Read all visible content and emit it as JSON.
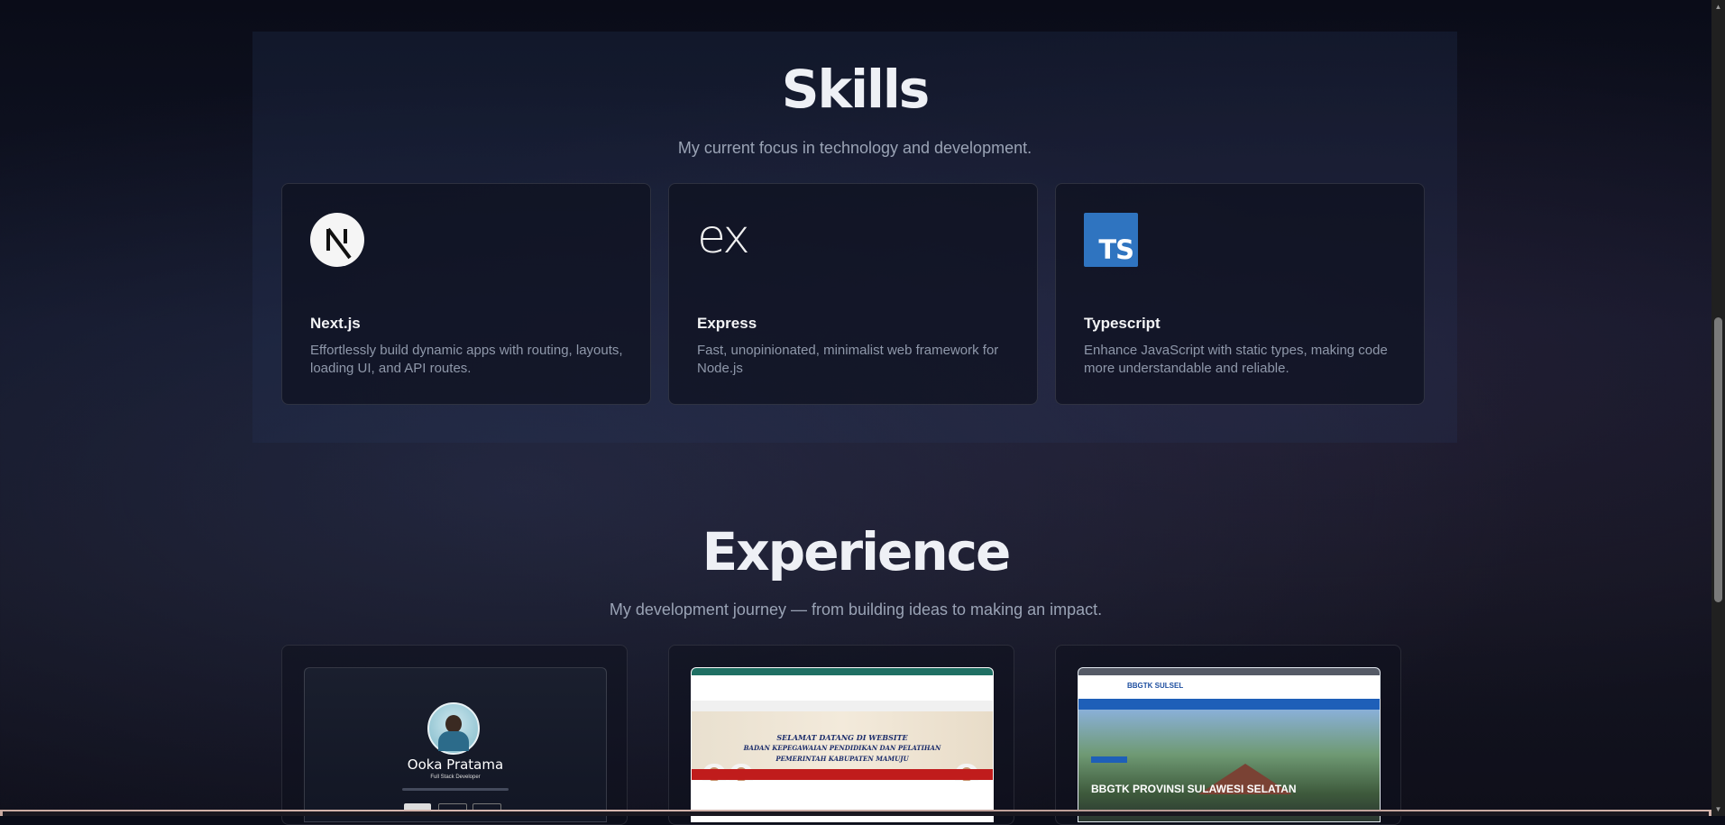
{
  "skills": {
    "title": "Skills",
    "subtitle": "My current focus in technology and development.",
    "cards": [
      {
        "name": "Next.js",
        "description": "Effortlessly build dynamic apps with routing, layouts, loading UI, and API routes.",
        "icon": "nextjs-logo"
      },
      {
        "name": "Express",
        "description": "Fast, unopinionated, minimalist web framework for Node.js",
        "icon": "express-logo",
        "logo_text": "ex"
      },
      {
        "name": "Typescript",
        "description": "Enhance JavaScript with static types, making code more understandable and reliable.",
        "icon": "typescript-logo",
        "logo_text": "TS"
      }
    ]
  },
  "experience": {
    "title": "Experience",
    "subtitle": "My development journey — from building ideas to making an impact.",
    "cards": [
      {
        "shot_name": "Ooka Pratama",
        "shot_role": "Full Stack Developer"
      },
      {
        "banner_line1": "SELAMAT DATANG DI WEBSITE",
        "banner_line2": "BADAN KEPEGAWAIAN PENDIDIKAN DAN PELATIHAN",
        "banner_line3": "PEMERINTAH KABUPATEN MAMUJU"
      },
      {
        "logo": "BBGTK SULSEL",
        "title": "BBGTK PROVINSI SULAWESI SELATAN"
      }
    ]
  },
  "colors": {
    "ts_blue": "#2f74c0",
    "background": "#121628"
  }
}
